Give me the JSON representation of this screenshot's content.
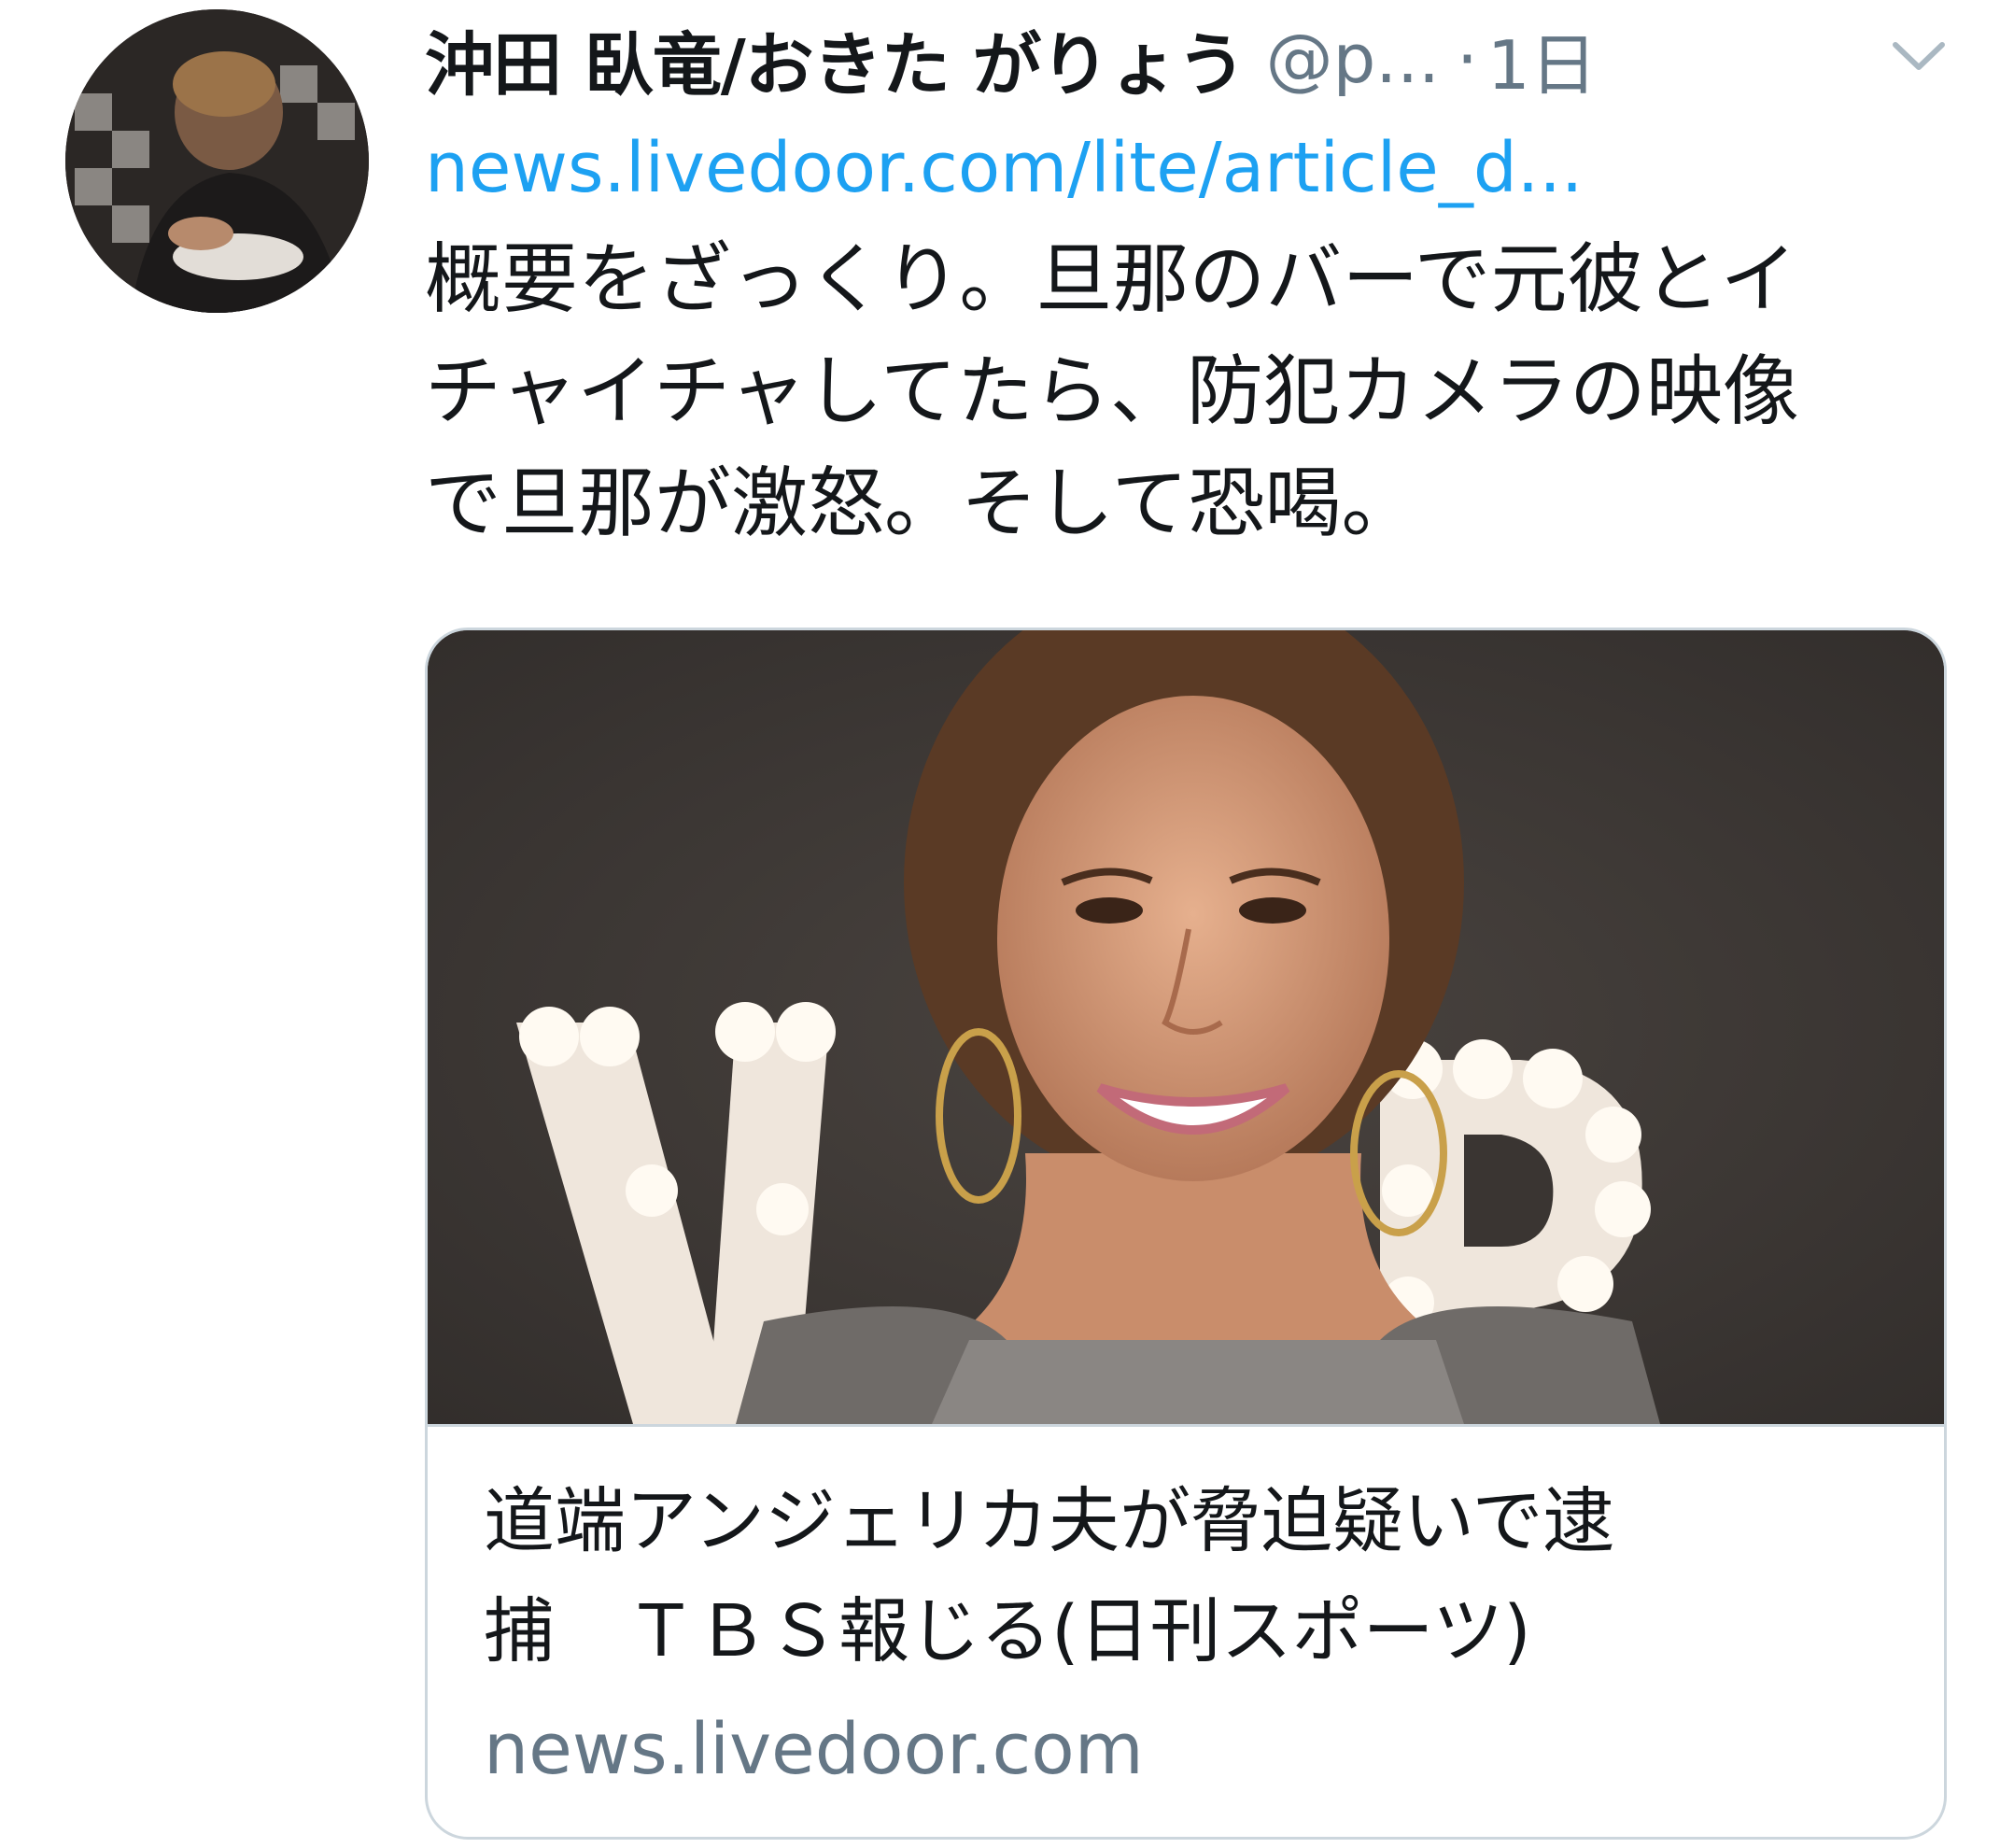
{
  "tweet": {
    "author": {
      "display_name": "沖田 臥竜/おきた がりょう",
      "handle": "@p...",
      "avatar_icon": "user-avatar-photo"
    },
    "time": "1日",
    "separator": "·",
    "link_text": "news.livedoor.com/lite/article_d...",
    "text": "概要をざっくり。旦那のバーで元彼とイ\nチャイチャしてたら、防犯カメラの映像\nで旦那が激怒。そして恐喝。",
    "menu_icon": "chevron-down-icon"
  },
  "card": {
    "image_icon": "article-photo",
    "title": "道端アンジェリカ夫が脅迫疑いで逮\n捕　ＴＢＳ報じる(日刊スポーツ)",
    "domain": "news.livedoor.com"
  },
  "colors": {
    "link": "#1da1f2",
    "secondary_text": "#657786",
    "border": "#ccd6dd",
    "primary_text": "#14171a"
  }
}
